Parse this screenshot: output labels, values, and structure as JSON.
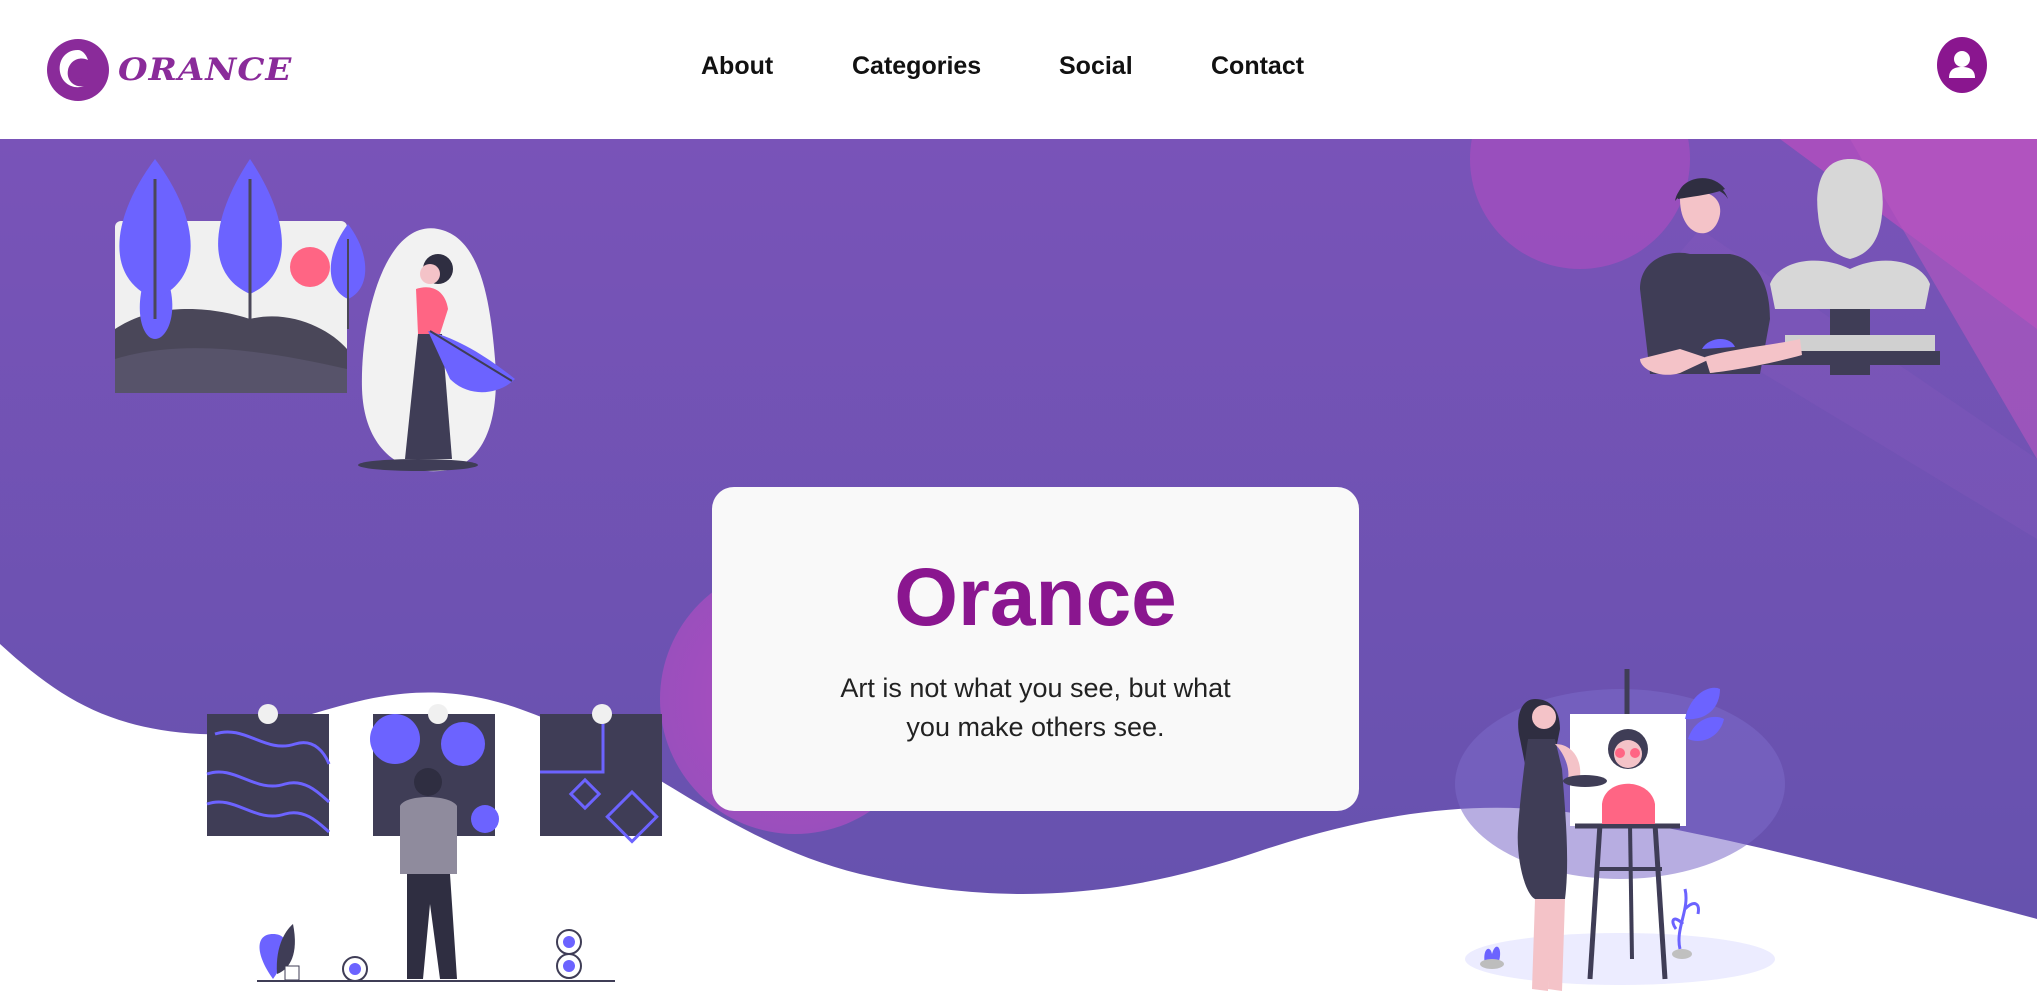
{
  "brand": {
    "name": "ORANCE",
    "colors": {
      "primary": "#8a168f",
      "hero_top": "#7a54b8",
      "hero_bottom": "#6a52ae",
      "accent_pink": "#b04cc0",
      "illustration_blue": "#6c63ff"
    }
  },
  "nav": {
    "items": [
      {
        "label": "About"
      },
      {
        "label": "Categories"
      },
      {
        "label": "Social"
      },
      {
        "label": "Contact"
      }
    ]
  },
  "profile": {
    "icon": "user-avatar-icon"
  },
  "hero": {
    "title": "Orance",
    "subtitle": "Art is not what you see, but what you make others see.",
    "illustrations": [
      "landscape-painting-woman",
      "sculptor-with-bust",
      "gallery-visitor",
      "painter-at-easel"
    ]
  }
}
